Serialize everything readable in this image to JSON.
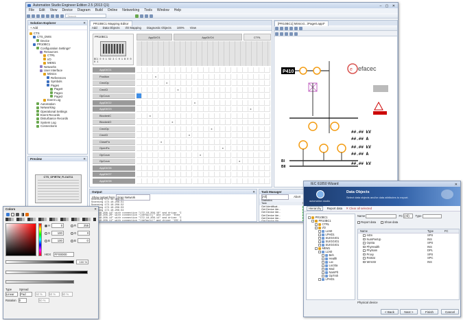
{
  "app": {
    "title": "Automation Studio Engineer Edition 2.5 (2013 Q1)",
    "menu": [
      "File",
      "Edit",
      "View",
      "Device",
      "Diagram",
      "Build",
      "Online",
      "Networking",
      "Tools",
      "Window",
      "Help"
    ],
    "search_placeholder": "Search"
  },
  "solution_explorer": {
    "title": "Solution Explorer",
    "add_label": "Add",
    "items": [
      {
        "label": "CTS",
        "depth": 0
      },
      {
        "label": "CTS_DWS",
        "depth": 1
      },
      {
        "label": "Device",
        "depth": 2
      },
      {
        "label": "PR10BC1",
        "depth": 1
      },
      {
        "label": "Configuration Settings*",
        "depth": 2
      },
      {
        "label": "Resources",
        "depth": 3
      },
      {
        "label": "CTRL",
        "depth": 4
      },
      {
        "label": "I/O",
        "depth": 4
      },
      {
        "label": "MEM1",
        "depth": 4
      },
      {
        "label": "Networks",
        "depth": 3
      },
      {
        "label": "User Interface",
        "depth": 3
      },
      {
        "label": "Mimics",
        "depth": 4
      },
      {
        "label": "References",
        "depth": 5
      },
      {
        "label": "Symbols",
        "depth": 5
      },
      {
        "label": "Pages",
        "depth": 5
      },
      {
        "label": "Page0",
        "depth": 6
      },
      {
        "label": "Page1",
        "depth": 6
      },
      {
        "label": "Page2",
        "depth": 6
      },
      {
        "label": "Event Log",
        "depth": 4
      },
      {
        "label": "Automation",
        "depth": 2
      },
      {
        "label": "Networking",
        "depth": 2
      },
      {
        "label": "Operational Settings",
        "depth": 2
      },
      {
        "label": "Event Records",
        "depth": 2
      },
      {
        "label": "Disturbance Records",
        "depth": 2
      },
      {
        "label": "System Log",
        "depth": 2
      },
      {
        "label": "Connections",
        "depth": 2
      }
    ]
  },
  "preview": {
    "title": "Preview",
    "device_title": "CTS_OPIRTM_FLOAT11"
  },
  "mapping_editor": {
    "tab": "PR10BC1 Mapping Editor",
    "toolbar": [
      "Add",
      "Data Objects",
      "I/O Mapping",
      "Diagnostic Objects",
      "100%",
      "View"
    ],
    "device_label": "PR10BC1",
    "group_a": "AppDI/O1",
    "group_b": "AppDI/O4",
    "group_c": "CTRL",
    "rows": [
      "AppDI/O1",
      "Position",
      "CmdOp",
      "CmdCl",
      "OpCoun",
      "AppDI/O2",
      "AppDI/O3",
      "BlockedC",
      "BlockedO",
      "CmdOp",
      "CmdCl",
      "CloseFa",
      "OpenFa",
      "OpCoun",
      "OpCoun",
      "AppDI/O6",
      "AppDI/O7",
      "AppDI/O8"
    ]
  },
  "mimic": {
    "tab": "[PR10BC1] Mimics\\...\\Page0.appt*",
    "brand": "efacec",
    "label_tag": "P410",
    "reading_1": "##.## kV",
    "reading_2": "##.## A",
    "reading_3": "##.## kV",
    "reading_4": "##.## A",
    "reading_5": "##.## kV",
    "bus_1": "BI",
    "bus_2": "BII"
  },
  "output": {
    "title": "Output",
    "show_from_label": "Show output from:",
    "show_from_value": "Scan Network",
    "lines": [
      "Scanning 172.18.208.55",
      "Scanning 172.18.208.51",
      "Scanning 172.18.208.52",
      "Scanning 172.18.208.53",
      "Scanning 172.18.208.54",
      "\"172.18.208.14\" with connection \"172.18.208.19\" and driver 'I",
      "\"172.18.208.20\" with connection \"(default)\" and driver 'Ethe",
      "\"172.18.208.14\" with connection \"172.18.208.14\" and driver 'I",
      "\"172.18.208.11\" with connection \"(default)\" and driver 'IEC 6",
      "\"172.18.208.30\" with connection \"(default)\" and driver 'Ethe",
      "\"172.18.208.17\" with connection \"(default)\" and driver 'IEC 6",
      "\"172.18.208.27\" with connection \"(default)\" and driver 'Ethe",
      "\"172.18.208.28\" with connection \"(default)\" and driver 'Ethe",
      "\"172.18.208.29\" with connection \"(default)\" and driver 'Ethe"
    ]
  },
  "task_manager": {
    "title": "Task Manager",
    "filter": "[All]",
    "abort_label": "Abort",
    "abort_all_label": "Abort All",
    "statistics_label": "Statistics",
    "columns": [
      "Task",
      "Progress",
      "Status"
    ],
    "tasks": [
      {
        "name": "Get Identificat...",
        "progress": 0.9,
        "status": "Running"
      },
      {
        "name": "Get Device Ide...",
        "progress": 0.9,
        "status": "Running"
      },
      {
        "name": "Get Device Ide...",
        "progress": 0.75,
        "status": "Running"
      },
      {
        "name": "Get Device Ide...",
        "progress": 0.6,
        "status": "Running"
      },
      {
        "name": "Get Device Ide...",
        "progress": 0.85,
        "status": "Running"
      },
      {
        "name": "Get Device Ide...",
        "progress": 0.5,
        "status": "Running"
      }
    ]
  },
  "colors_panel": {
    "title": "Colors",
    "hex_label": "HEX",
    "hex_value": "FF00000",
    "opacity_value": "100 %",
    "fields": [
      "H",
      "S",
      "B",
      "R",
      "G",
      "B"
    ],
    "field_values": [
      "0",
      "100",
      "100",
      "255",
      "0",
      "0"
    ],
    "type_label": "Type",
    "type_value": "Linear",
    "spread_label": "Spread",
    "spread_value": "Pad",
    "rotation_label": "Rotation",
    "rotation_value": "0",
    "percent_values": [
      "50 %",
      "50 %",
      "50 %",
      "50 %"
    ],
    "colors": {
      "main": "#ff0000"
    }
  },
  "wizard": {
    "title": "IEC 61850 Wizard",
    "header_title": "Data Objects",
    "header_sub": "Select data objects and/or data attributes to export.",
    "brand": "automation studio",
    "hierarchy_label": "Hierarchy",
    "report_label": "Report data",
    "clear_label": "Clear all selected",
    "name_label": "Name",
    "fc_label": "FC",
    "fc_value": "(All)",
    "type_label": "Type",
    "report_check": "Report data",
    "show_check": "Show data",
    "columns": [
      "Name",
      "Type",
      "FC"
    ],
    "tree": [
      "PR10BC1",
      "PR10BC1",
      "CTRL",
      "I/O",
      "LLN0",
      "LPHD1",
      "SUIGGIO1",
      "SUIGGIO1",
      "SUIGGIO1",
      "MEM1",
      "LLN0",
      "Beh",
      "Health",
      "Loc",
      "LocSta",
      "Mod",
      "NamPlt",
      "OpTmh",
      "LPHD1"
    ],
    "rows": [
      {
        "name": "InDn",
        "type": "SPS",
        "fc": ""
      },
      {
        "name": "NumPwrUp",
        "type": "INS",
        "fc": ""
      },
      {
        "name": "OpSta",
        "type": "SPS",
        "fc": ""
      },
      {
        "name": "PhyHealth",
        "type": "INS",
        "fc": ""
      },
      {
        "name": "PhyNam",
        "type": "DPL",
        "fc": ""
      },
      {
        "name": "Proxy",
        "type": "SPS",
        "fc": ""
      },
      {
        "name": "RsStat",
        "type": "SPC",
        "fc": ""
      },
      {
        "name": "WrmStr",
        "type": "INS",
        "fc": ""
      }
    ],
    "footer_label": "Physical device",
    "buttons": [
      "< Back",
      "Next >",
      "Finish",
      "Cancel"
    ]
  }
}
